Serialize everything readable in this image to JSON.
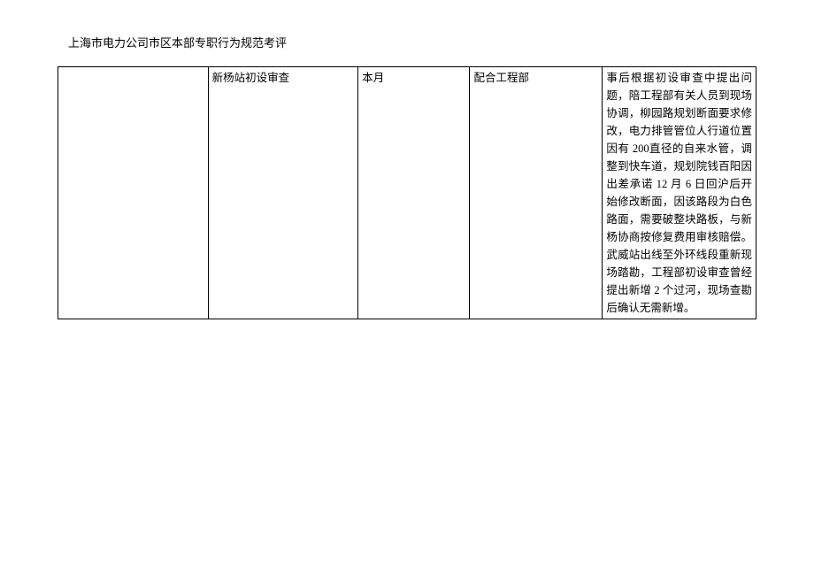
{
  "document": {
    "title": "上海市电力公司市区本部专职行为规范考评"
  },
  "table": {
    "row": {
      "col1": "",
      "col2": "新杨站初设审查",
      "col3": "本月",
      "col4": "配合工程部",
      "col5": "事后根据初设审查中提出问题，陪工程部有关人员到现场协调，柳园路规划断面要求修改，电力排管管位人行道位置因有 200直径的自来水管，调整到快车道，规划院钱百阳因出差承诺 12 月 6 日回沪后开始修改断面，因该路段为白色路面，需要破整块路板，与新杨协商按修复费用审核赔偿。武威站出线至外环线段重新现场踏勘，工程部初设审查曾经提出新增 2 个过河，现场查勘后确认无需新增。"
    }
  }
}
